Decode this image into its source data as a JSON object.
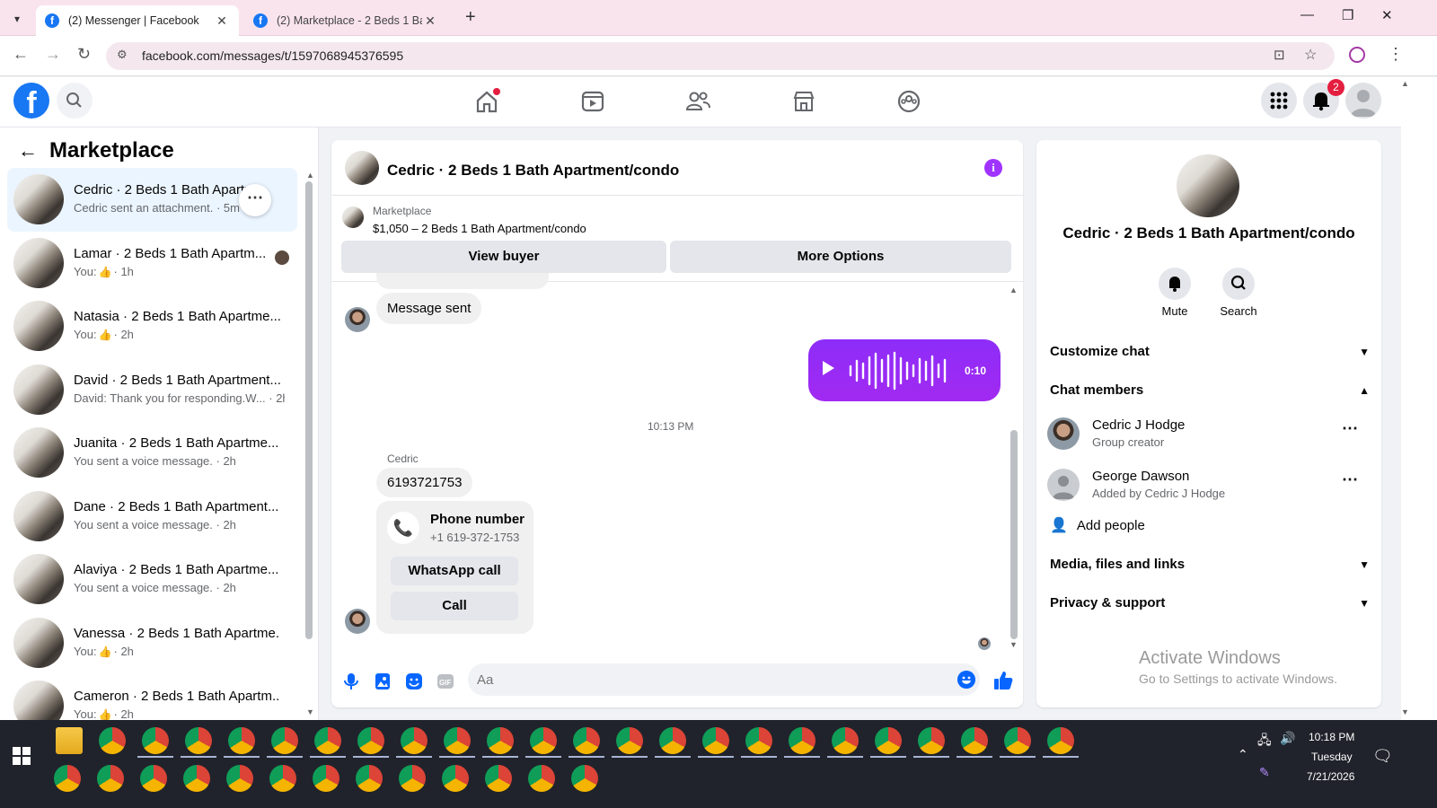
{
  "browser": {
    "tabs": [
      {
        "title": "(2) Messenger | Facebook",
        "active": true
      },
      {
        "title": "(2) Marketplace - 2 Beds 1 Bath",
        "active": false
      }
    ],
    "url": "facebook.com/messages/t/1597068945376595"
  },
  "header": {
    "notifications_badge": "2"
  },
  "sidebar": {
    "title": "Marketplace",
    "conversations": [
      {
        "name": "Cedric · 2 Beds 1 Bath Apartm...",
        "preview": "Cedric sent an attachment. · 5m",
        "active": true
      },
      {
        "name": "Lamar · 2 Beds 1 Bath Apartm...",
        "preview_prefix": "You:",
        "preview_time": "· 1h",
        "liked": true
      },
      {
        "name": "Natasia · 2 Beds 1 Bath Apartme...",
        "preview_prefix": "You:",
        "preview_time": "· 2h",
        "liked": true
      },
      {
        "name": "David · 2 Beds 1 Bath Apartment...",
        "preview": "David: Thank you for responding.W... · 2h"
      },
      {
        "name": "Juanita · 2 Beds 1 Bath Apartme...",
        "preview": "You sent a voice message. · 2h"
      },
      {
        "name": "Dane · 2 Beds 1 Bath Apartment...",
        "preview": "You sent a voice message. · 2h"
      },
      {
        "name": "Alaviya · 2 Beds 1 Bath Apartme...",
        "preview": "You sent a voice message. · 2h"
      },
      {
        "name": "Vanessa · 2 Beds 1 Bath Apartme...",
        "preview_prefix": "You:",
        "preview_time": "· 2h",
        "liked": true
      },
      {
        "name": "Cameron · 2 Beds 1 Bath Apartm...",
        "preview_prefix": "You:",
        "preview_time": "· 2h",
        "liked": true
      }
    ]
  },
  "chat": {
    "title": "Cedric · 2 Beds 1 Bath Apartment/condo",
    "marketplace_label": "Marketplace",
    "listing": "$1,050 – 2 Beds 1 Bath Apartment/condo",
    "view_buyer": "View buyer",
    "more_options": "More Options",
    "messages": {
      "sent_status": "Message sent",
      "voice_duration": "0:10",
      "timestamp": "10:13 PM",
      "sender_name": "Cedric",
      "phone_text": "6193721753",
      "phone_card_title": "Phone number",
      "phone_card_number": "+1 619-372-1753",
      "whatsapp_call": "WhatsApp call",
      "call": "Call"
    },
    "composer_placeholder": "Aa"
  },
  "details": {
    "title": "Cedric · 2 Beds 1 Bath Apartment/condo",
    "mute": "Mute",
    "search": "Search",
    "customize_chat": "Customize chat",
    "chat_members": "Chat members",
    "members": [
      {
        "name": "Cedric J Hodge",
        "role": "Group creator"
      },
      {
        "name": "George Dawson",
        "role": "Added by Cedric J Hodge"
      }
    ],
    "add_people": "Add people",
    "media": "Media, files and links",
    "privacy": "Privacy & support",
    "activate_title": "Activate Windows",
    "activate_sub": "Go to Settings to activate Windows."
  },
  "taskbar": {
    "time": "10:18 PM",
    "day": "Tuesday",
    "date": "7/21/2026"
  },
  "colors": {
    "facebook_blue": "#1877f2",
    "messenger_purple": "#9a2cf5",
    "notification_red": "#e41e3f"
  }
}
